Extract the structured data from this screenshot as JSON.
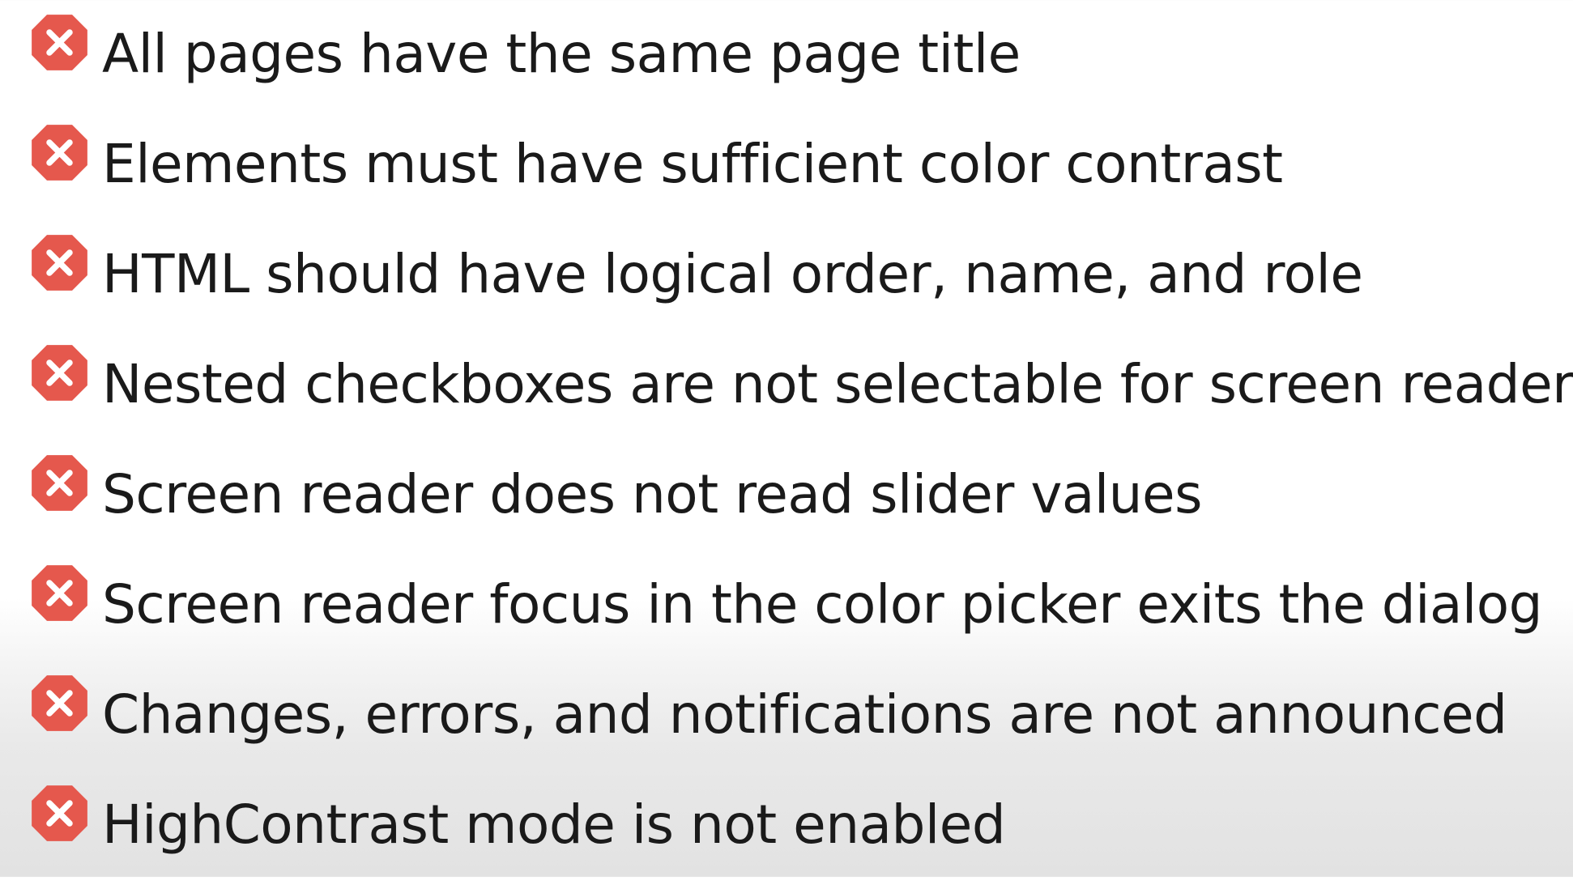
{
  "icon": {
    "name": "error-x-icon",
    "color": "#e5584d",
    "glyph_color": "#ffffff"
  },
  "items": [
    {
      "text": "All pages have the same page title"
    },
    {
      "text": "Elements must have sufficient color contrast"
    },
    {
      "text": "HTML should have logical order, name, and role"
    },
    {
      "text": "Nested checkboxes are not selectable for screen readers"
    },
    {
      "text": "Screen reader does not read slider values"
    },
    {
      "text": "Screen reader focus in the color picker exits the dialog"
    },
    {
      "text": "Changes, errors, and notifications are not announced"
    },
    {
      "text": "HighContrast mode is not enabled"
    }
  ]
}
